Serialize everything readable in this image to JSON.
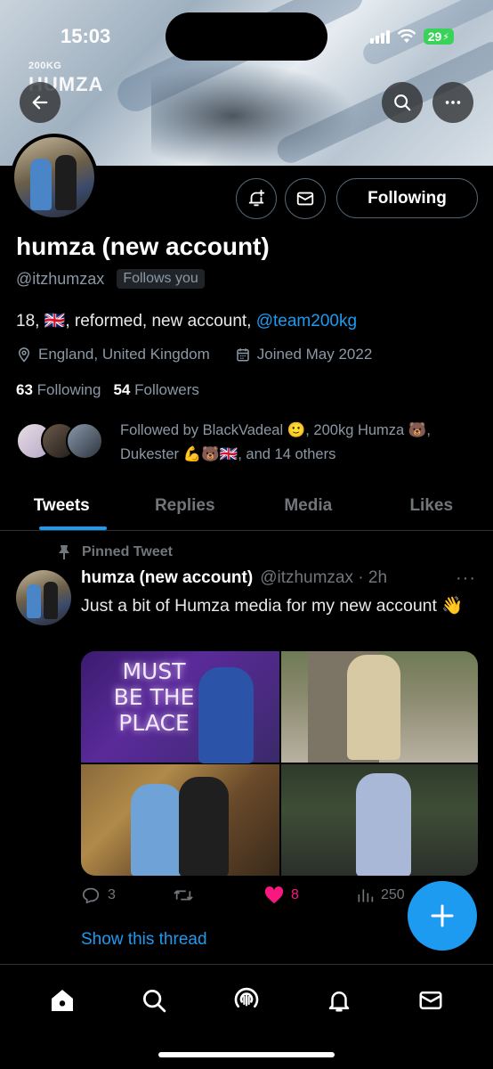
{
  "status_bar": {
    "time": "15:03",
    "battery": "29"
  },
  "banner": {
    "brand_small": "200KG",
    "brand_big": "HUMZA"
  },
  "header_buttons": {
    "back_icon": "arrow-left-icon",
    "search_icon": "search-icon",
    "more_icon": "more-icon"
  },
  "profile": {
    "display_name": "humza (new account)",
    "handle": "@itzhumzax",
    "follows_you": "Follows you",
    "bio_prefix": "18, 🇬🇧, reformed, new account, ",
    "bio_link": "@team200kg",
    "location": "England, United Kingdom",
    "joined": "Joined May 2022",
    "following_count": "63",
    "following_label": "Following",
    "followers_count": "54",
    "followers_label": "Followers",
    "followed_by": "Followed by BlackVadeal 🙂, 200kg Humza 🐻, Dukester 💪🐻🇬🇧, and 14 others",
    "following_button": "Following"
  },
  "tabs": [
    {
      "label": "Tweets",
      "active": true
    },
    {
      "label": "Replies",
      "active": false
    },
    {
      "label": "Media",
      "active": false
    },
    {
      "label": "Likes",
      "active": false
    }
  ],
  "tweet": {
    "pinned_label": "Pinned Tweet",
    "author_name": "humza (new account)",
    "author_handle": "@itzhumzax · 2h",
    "more": "···",
    "text": "Just a bit of Humza media for my new account 👋",
    "neon_sign": "MUST BE THE PLACE",
    "replies": "3",
    "retweets": "",
    "likes": "8",
    "views": "250",
    "show_thread": "Show this thread"
  },
  "colors": {
    "accent": "#1d9bf0",
    "like": "#f91880",
    "muted": "#71767b",
    "background": "#000000"
  },
  "bottom_nav": [
    "home-icon",
    "search-icon",
    "spaces-icon",
    "notifications-icon",
    "messages-icon"
  ]
}
